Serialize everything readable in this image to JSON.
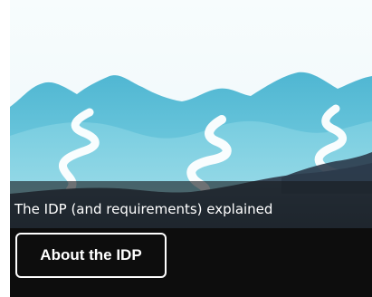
{
  "card": {
    "caption": "The IDP (and requirements) explained",
    "cta_label": "About the IDP"
  },
  "colors": {
    "sky": "#f4fbfd",
    "mountain": "#6cc7dc",
    "river": "#ffffff",
    "ridge": "#223040",
    "overlay": "#0d0d0d",
    "text": "#ffffff"
  }
}
